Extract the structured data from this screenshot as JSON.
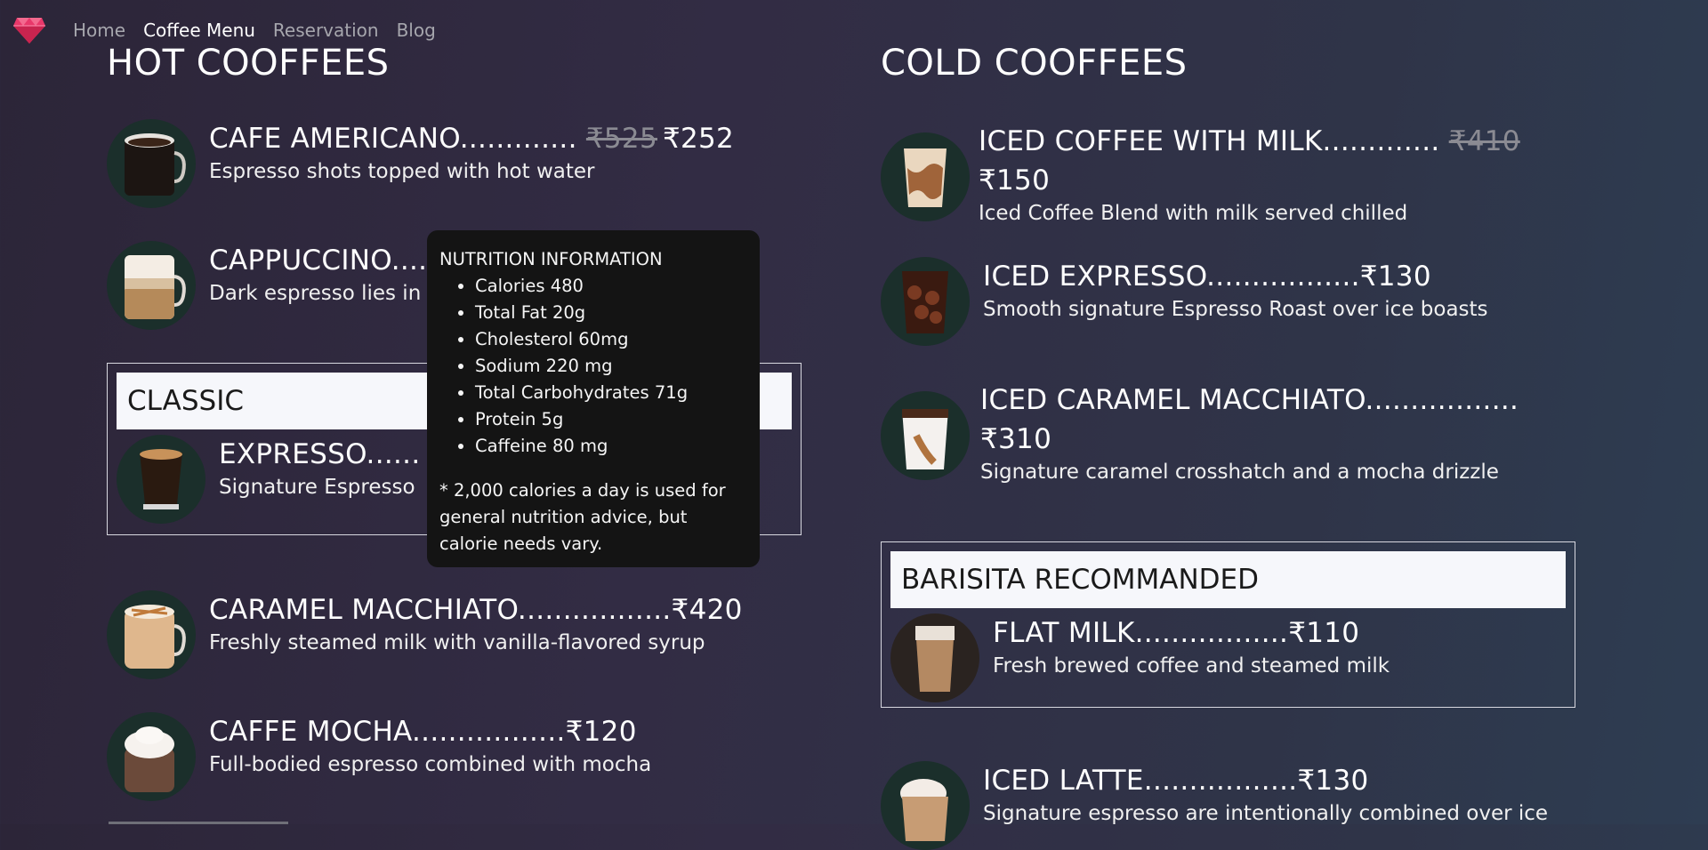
{
  "nav": {
    "links": [
      "Home",
      "Coffee Menu",
      "Reservation",
      "Blog"
    ],
    "active": "Coffee Menu"
  },
  "hot": {
    "title": "HOT COOFFEES",
    "items": [
      {
        "name": "CAFE AMERICANO............. ",
        "old_price": "₹525",
        "price": "₹252",
        "desc": "Espresso shots topped with hot water",
        "img": "hot-coffee-mug"
      },
      {
        "name": "CAPPUCCINO....",
        "desc": "Dark espresso lies in",
        "img": "cappuccino-glass"
      },
      {
        "name": "CARAMEL MACCHIATO.................₹420",
        "desc": "Freshly steamed milk with vanilla-flavored syrup",
        "img": "caramel-macchiato-mug"
      },
      {
        "name": "CAFFE MOCHA.................₹120",
        "desc": "Full-bodied espresso combined with mocha",
        "img": "mocha-mug"
      }
    ],
    "classic": {
      "label": "CLASSIC",
      "item": {
        "name": "EXPRESSO......",
        "desc": "Signature Espresso",
        "img": "espresso-glass"
      }
    }
  },
  "cold": {
    "title": "COLD COOFFEES",
    "items": [
      {
        "name": "ICED COFFEE WITH MILK............. ",
        "old_price": "₹410",
        "price": "₹150",
        "desc": "Iced Coffee Blend with milk served chilled",
        "img": "iced-coffee-milk"
      },
      {
        "name": "ICED EXPRESSO.................₹130",
        "desc": "Smooth signature Espresso Roast over ice boasts",
        "img": "iced-espresso"
      },
      {
        "name": "ICED CARAMEL MACCHIATO.................",
        "price": "₹310",
        "desc": "Signature caramel crosshatch and a mocha drizzle",
        "img": "iced-caramel-macchiato"
      },
      {
        "name": "ICED LATTE.................₹130",
        "desc": "Signature espresso are intentionally combined over ice",
        "img": "iced-latte"
      }
    ],
    "barista": {
      "label": "BARISITA RECOMMANDED",
      "item": {
        "name": "FLAT MILK.................₹110",
        "desc": "Fresh brewed coffee and steamed milk",
        "img": "flat-milk"
      }
    }
  },
  "tooltip": {
    "heading": "NUTRITION INFORMATION",
    "facts": [
      "Calories 480",
      "Total Fat 20g",
      "Cholesterol 60mg",
      "Sodium 220 mg",
      "Total Carbohydrates 71g",
      "Protein 5g",
      "Caffeine 80 mg"
    ],
    "note": "* 2,000 calories a day is used for general nutrition advice, but calorie needs vary."
  },
  "colors": {
    "logo": "#e8386a",
    "accent": "#ffffff",
    "muted": "#a6a6ad",
    "tooltip_bg": "#141414"
  }
}
